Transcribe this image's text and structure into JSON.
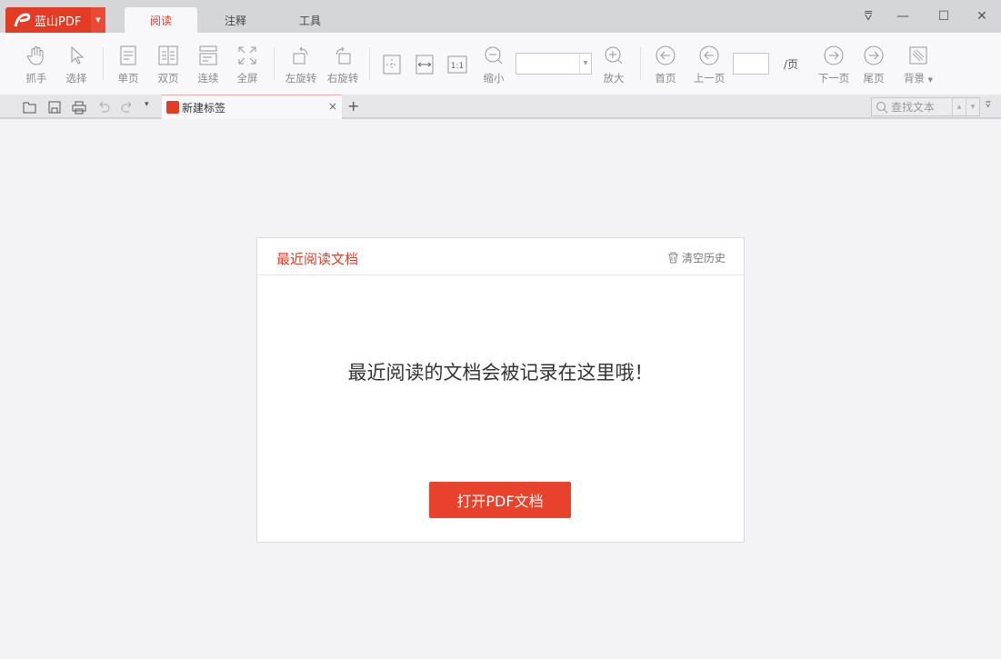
{
  "app": {
    "name": "蓝山PDF"
  },
  "menu_tabs": [
    {
      "label": "阅读",
      "active": true
    },
    {
      "label": "注释"
    },
    {
      "label": "工具"
    }
  ],
  "toolbar": {
    "grab": "抓手",
    "select": "选择",
    "single": "单页",
    "double": "双页",
    "continuous": "连续",
    "fullscreen": "全屏",
    "rotate_left": "左旋转",
    "rotate_right": "右旋转",
    "zoom_out": "缩小",
    "zoom_value": "",
    "zoom_in": "放大",
    "first": "首页",
    "prev": "上一页",
    "page_value": "",
    "page_suffix": "/页",
    "next": "下一页",
    "last": "尾页",
    "background": "背景"
  },
  "doc_tab": {
    "label": "新建标签",
    "close": "×",
    "add": "+"
  },
  "search": {
    "placeholder": "查找文本"
  },
  "recent": {
    "title": "最近阅读文档",
    "clear": "清空历史",
    "empty_message": "最近阅读的文档会被记录在这里哦！",
    "open_button": "打开PDF文档"
  },
  "colors": {
    "accent": "#e8412c"
  }
}
